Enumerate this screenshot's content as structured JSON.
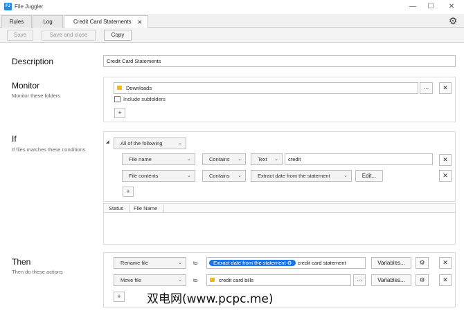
{
  "window": {
    "title": "File Juggler",
    "minimize": "—",
    "maximize": "☐",
    "close": "✕"
  },
  "tabs": [
    {
      "label": "Rules"
    },
    {
      "label": "Log"
    },
    {
      "label": "Credit Card Statements",
      "close": "✕"
    }
  ],
  "toolbar": {
    "save_label": "Save",
    "save_close_label": "Save and close",
    "copy_label": "Copy"
  },
  "description": {
    "heading": "Description",
    "value": "Credit Card Statements"
  },
  "monitor": {
    "heading": "Monitor",
    "subheading": "Monitor these folders",
    "folder": "Downloads",
    "browse": "...",
    "remove": "✕",
    "include_subfolders": "Include subfolders",
    "add": "+"
  },
  "if": {
    "heading": "If",
    "subheading": "If files matches these conditions",
    "collapse": "◢",
    "mode": "All of the following",
    "conditions": [
      {
        "field": "File name",
        "operator": "Contains",
        "type": "Text",
        "value": "credit",
        "remove": "✕"
      },
      {
        "field": "File contents",
        "operator": "Contains",
        "type": "Extract date from the statement",
        "edit": "Edit...",
        "remove": "✕"
      }
    ],
    "add": "+",
    "table": {
      "columns": [
        "Status",
        "File Name"
      ]
    }
  },
  "then": {
    "heading": "Then",
    "subheading": "Then do these actions",
    "actions": [
      {
        "action": "Rename file",
        "to": "to",
        "token": "Extract date from the statement",
        "value": "credit card statement",
        "variables": "Variables...",
        "remove": "✕"
      },
      {
        "action": "Move file",
        "to": "to",
        "value": "credit card bills",
        "browse": "...",
        "variables": "Variables...",
        "remove": "✕"
      }
    ],
    "add": "+"
  },
  "watermark": "双电网(www.pcpc.me)",
  "icons": {
    "settings": "gear-icon",
    "folder": "folder-icon",
    "dropdown": "chevron-down-icon"
  },
  "colors": {
    "accent": "#1a73e8",
    "folder": "#f2b90f",
    "app_icon": "#1e88e5"
  }
}
